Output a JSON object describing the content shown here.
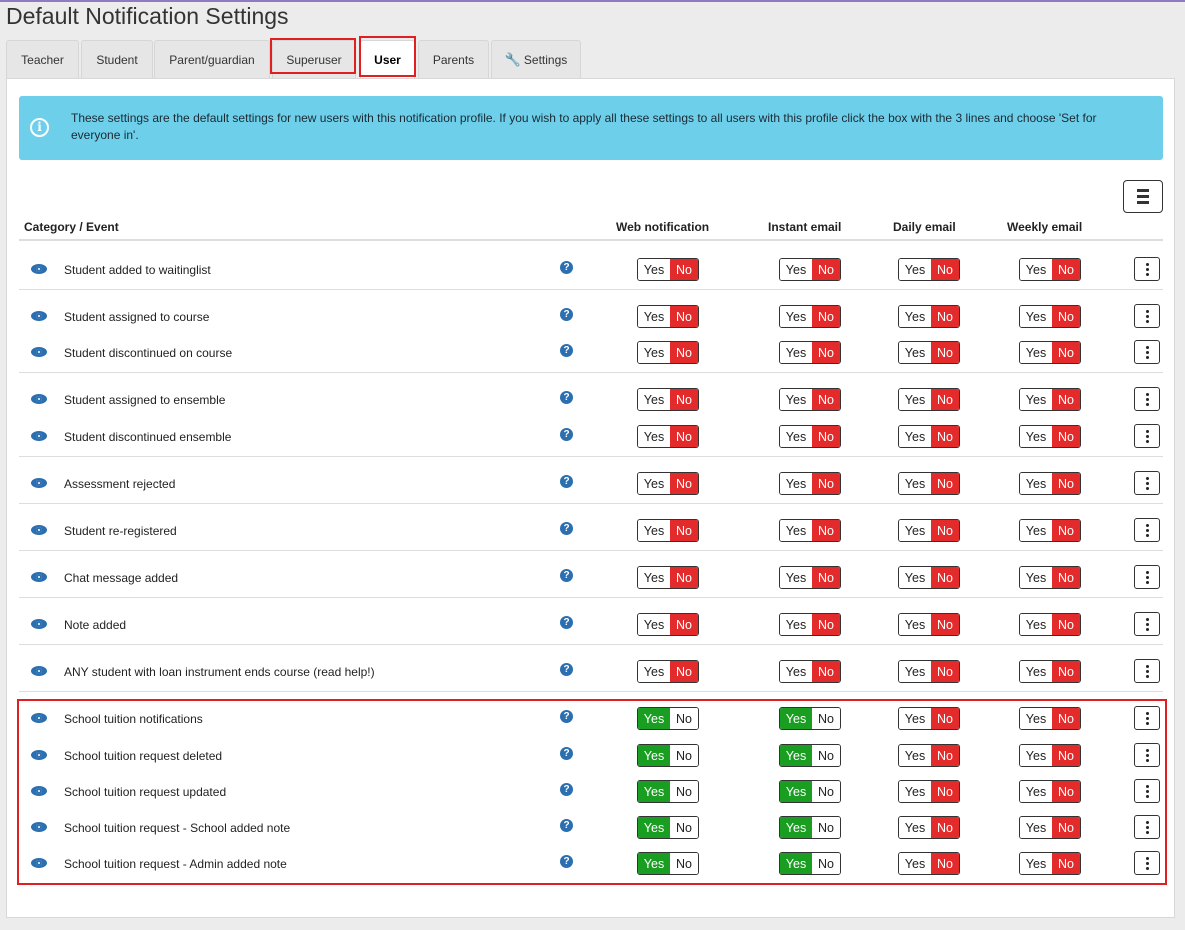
{
  "page": {
    "title": "Default Notification Settings"
  },
  "tabs": [
    {
      "label": "Teacher"
    },
    {
      "label": "Student"
    },
    {
      "label": "Parent/guardian"
    },
    {
      "label": "Superuser"
    },
    {
      "label": "User"
    },
    {
      "label": "Parents"
    },
    {
      "label": "Settings",
      "icon": "wrench-icon"
    }
  ],
  "active_tab": "User",
  "alert": {
    "text": "These settings are the default settings for new users with this notification profile. If you wish to apply all these settings to all users with this profile click the box with the 3 lines and choose 'Set for everyone in'."
  },
  "table": {
    "headers": {
      "category": "Category / Event",
      "web": "Web notification",
      "instant": "Instant email",
      "daily": "Daily email",
      "weekly": "Weekly email"
    },
    "toggle_labels": {
      "yes": "Yes",
      "no": "No"
    },
    "rows": [
      {
        "label": "Student added to waitinglist",
        "web": false,
        "instant": false,
        "daily": false,
        "weekly": false
      },
      {
        "label": "Student assigned to course",
        "web": false,
        "instant": false,
        "daily": false,
        "weekly": false
      },
      {
        "label": "Student discontinued on course",
        "web": false,
        "instant": false,
        "daily": false,
        "weekly": false
      },
      {
        "label": "Student assigned to ensemble",
        "web": false,
        "instant": false,
        "daily": false,
        "weekly": false
      },
      {
        "label": "Student discontinued ensemble",
        "web": false,
        "instant": false,
        "daily": false,
        "weekly": false
      },
      {
        "label": "Assessment rejected",
        "web": false,
        "instant": false,
        "daily": false,
        "weekly": false
      },
      {
        "label": "Student re-registered",
        "web": false,
        "instant": false,
        "daily": false,
        "weekly": false
      },
      {
        "label": "Chat message added",
        "web": false,
        "instant": false,
        "daily": false,
        "weekly": false
      },
      {
        "label": "Note added",
        "web": false,
        "instant": false,
        "daily": false,
        "weekly": false
      },
      {
        "label": "ANY student with loan instrument ends course (read help!)",
        "web": false,
        "instant": false,
        "daily": false,
        "weekly": false
      },
      {
        "label": "School tuition notifications",
        "web": true,
        "instant": true,
        "daily": false,
        "weekly": false
      },
      {
        "label": "School tuition request deleted",
        "web": true,
        "instant": true,
        "daily": false,
        "weekly": false
      },
      {
        "label": "School tuition request updated",
        "web": true,
        "instant": true,
        "daily": false,
        "weekly": false
      },
      {
        "label": "School tuition request - School added note",
        "web": true,
        "instant": true,
        "daily": false,
        "weekly": false
      },
      {
        "label": "School tuition request - Admin added note",
        "web": true,
        "instant": true,
        "daily": false,
        "weekly": false
      }
    ]
  },
  "colors": {
    "yes_active": "#1a9e22",
    "no_active": "#e32b2b",
    "alert_bg": "#6ecfea",
    "highlight": "#e02020"
  }
}
